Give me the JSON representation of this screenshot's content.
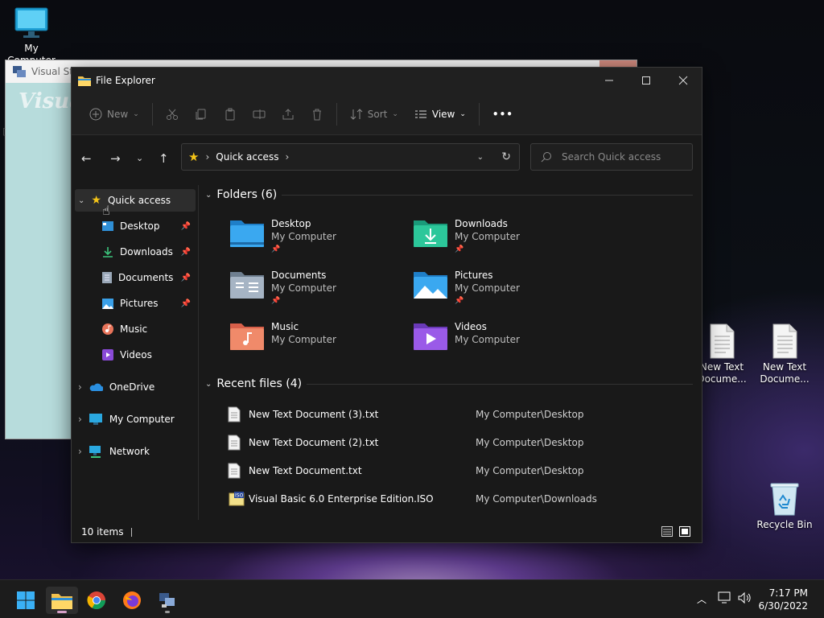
{
  "desktop": {
    "my_computer_label": "My Computer",
    "txt1_label": "New Text Docume...",
    "txt2_label": "New Text Docume...",
    "recycle_label": "Recycle Bin"
  },
  "vb_window": {
    "title": "Visual Stu",
    "heading": "Visua",
    "edge_char": "["
  },
  "explorer": {
    "title": "File Explorer",
    "cmd": {
      "new": "New",
      "sort": "Sort",
      "view": "View",
      "more": "•••"
    },
    "address": {
      "location": "Quick access",
      "chevron": "›"
    },
    "search_placeholder": "Search Quick access",
    "sidebar": [
      {
        "label": "Quick access"
      },
      {
        "label": "Desktop"
      },
      {
        "label": "Downloads"
      },
      {
        "label": "Documents"
      },
      {
        "label": "Pictures"
      },
      {
        "label": "Music"
      },
      {
        "label": "Videos"
      },
      {
        "label": "OneDrive"
      },
      {
        "label": "My Computer"
      },
      {
        "label": "Network"
      }
    ],
    "folders_header": "Folders (6)",
    "folders": [
      {
        "name": "Desktop",
        "sub": "My Computer"
      },
      {
        "name": "Downloads",
        "sub": "My Computer"
      },
      {
        "name": "Documents",
        "sub": "My Computer"
      },
      {
        "name": "Pictures",
        "sub": "My Computer"
      },
      {
        "name": "Music",
        "sub": "My Computer"
      },
      {
        "name": "Videos",
        "sub": "My Computer"
      }
    ],
    "recent_header": "Recent files (4)",
    "recent": [
      {
        "name": "New Text Document (3).txt",
        "loc": "My Computer\\Desktop"
      },
      {
        "name": "New Text Document (2).txt",
        "loc": "My Computer\\Desktop"
      },
      {
        "name": "New Text Document.txt",
        "loc": "My Computer\\Desktop"
      },
      {
        "name": "Visual Basic 6.0 Enterprise Edition.ISO",
        "loc": "My Computer\\Downloads"
      }
    ],
    "status": "10 items"
  },
  "taskbar": {
    "time": "7:17 PM",
    "date": "6/30/2022"
  }
}
